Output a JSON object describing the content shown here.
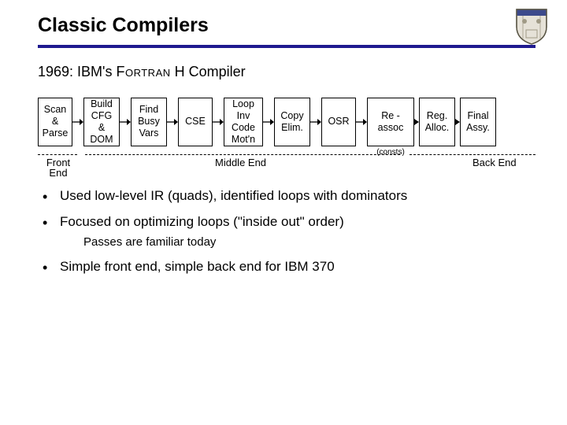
{
  "title": "Classic Compilers",
  "subtitle_prefix": "1969: IBM's ",
  "subtitle_smallcaps": "Fortran",
  "subtitle_suffix": " H Compiler",
  "pipeline": {
    "stages": {
      "scan_parse": "Scan\n&\nParse",
      "build_cfg": "Build\nCFG\n&\nDOM",
      "find_busy": "Find\nBusy\nVars",
      "cse": "CSE",
      "licm": "Loop\nInv\nCode\nMot'n",
      "copy_elim": "Copy\nElim.",
      "osr": "OSR",
      "reassoc": "Re -\nassoc",
      "reassoc_sub": "(consts)",
      "reg_alloc": "Reg.\nAlloc.",
      "final_assy": "Final\nAssy."
    },
    "sections": {
      "front": "Front\nEnd",
      "middle": "Middle End",
      "back": "Back End"
    }
  },
  "bullets": {
    "b1": "Used low-level IR (quads), identified loops with dominators",
    "b2": "Focused on optimizing loops (\"inside out\" order)",
    "b2_sub": "Passes are familiar today",
    "b3": "Simple front end, simple back end for IBM 370"
  }
}
